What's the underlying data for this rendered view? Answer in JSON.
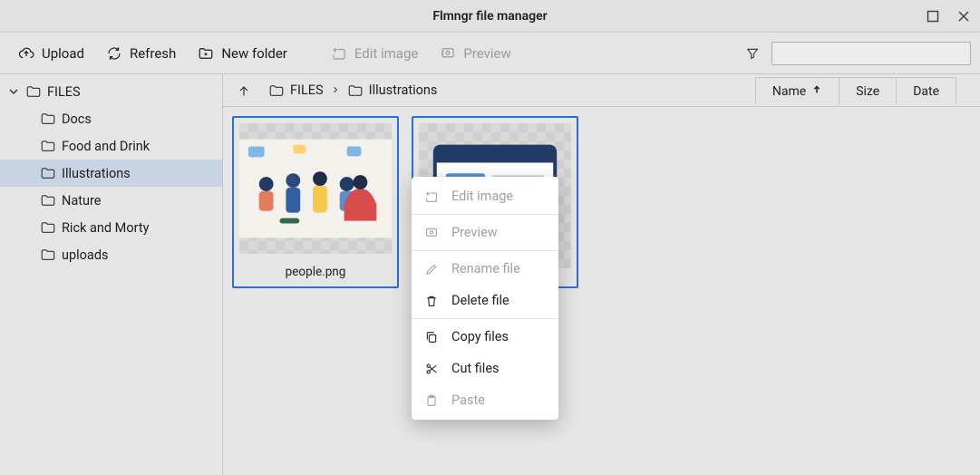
{
  "window": {
    "title": "Flmngr file manager"
  },
  "toolbar": {
    "upload": "Upload",
    "refresh": "Refresh",
    "new_folder": "New folder",
    "edit_image": "Edit image",
    "preview": "Preview"
  },
  "sidebar": {
    "root": "FILES",
    "items": [
      {
        "label": "Docs"
      },
      {
        "label": "Food and Drink"
      },
      {
        "label": "Illustrations",
        "selected": true
      },
      {
        "label": "Nature"
      },
      {
        "label": "Rick and Morty"
      },
      {
        "label": "uploads"
      }
    ]
  },
  "breadcrumb": {
    "segments": [
      "FILES",
      "Illustrations"
    ]
  },
  "columns": {
    "name": "Name",
    "size": "Size",
    "date": "Date",
    "sort_by": "name",
    "sort_dir": "asc"
  },
  "files": [
    {
      "name": "people.png"
    },
    {
      "name": ""
    }
  ],
  "context_menu": {
    "edit_image": "Edit image",
    "preview": "Preview",
    "rename": "Rename file",
    "delete": "Delete file",
    "copy": "Copy files",
    "cut": "Cut files",
    "paste": "Paste"
  }
}
